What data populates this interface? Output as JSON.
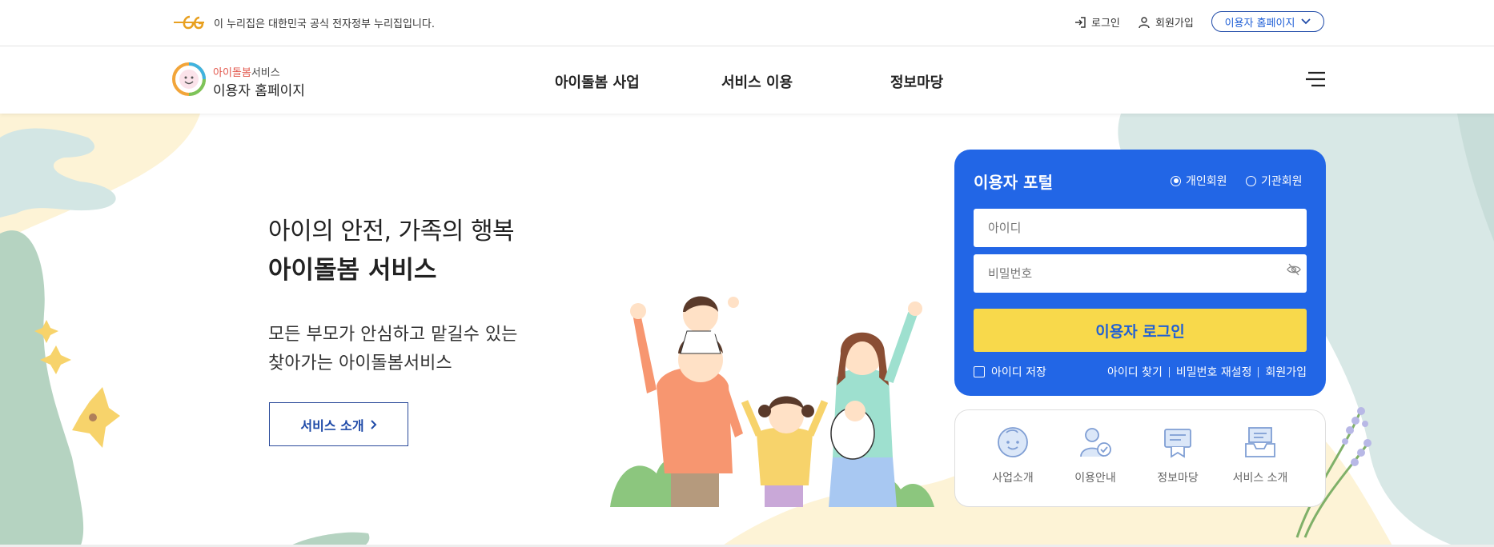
{
  "gov_banner": {
    "text": "이 누리집은 대한민국 공식 전자정부 누리집입니다.",
    "login": "로그인",
    "signup": "회원가입",
    "home_select": "이용자 홈페이지"
  },
  "header": {
    "brand_red": "아이돌봄",
    "brand_rest": "서비스",
    "brand_sub": "이용자 홈페이지",
    "menu": [
      "아이돌봄 사업",
      "서비스 이용",
      "정보마당"
    ]
  },
  "hero": {
    "line1": "아이의 안전, 가족의 행복",
    "line2": "아이돌봄 서비스",
    "desc1": "모든 부모가 안심하고 맡길수 있는",
    "desc2": "찾아가는 아이돌봄서비스",
    "intro_button": "서비스 소개"
  },
  "portal": {
    "title": "이용자 포털",
    "radio_personal": "개인회원",
    "radio_org": "기관회원",
    "id_placeholder": "아이디",
    "pw_placeholder": "비밀번호",
    "login_button": "이용자 로그인",
    "save_id": "아이디 저장",
    "find_id": "아이디 찾기",
    "reset_pw": "비밀번호 재설정",
    "signup": "회원가입"
  },
  "quick_links": [
    "사업소개",
    "이용안내",
    "정보마당",
    "서비스 소개"
  ],
  "colors": {
    "primary": "#2266e6",
    "accent_yellow": "#f8d94b",
    "text_blue": "#1f5fd6",
    "mint_bg": "#d8e8e6",
    "cream_bg": "#fdf3d6"
  }
}
